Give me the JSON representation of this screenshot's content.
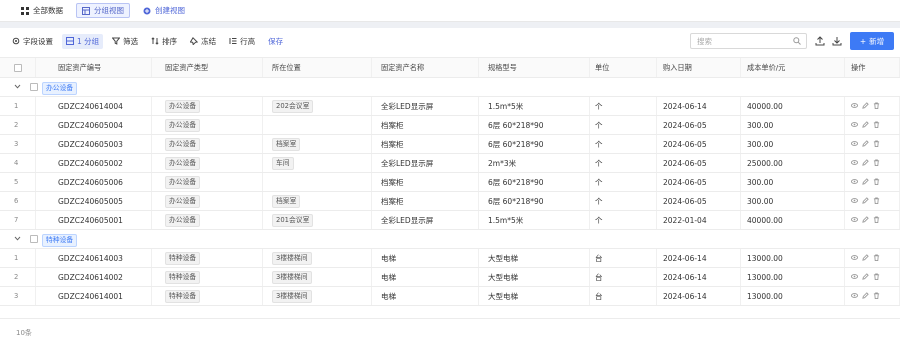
{
  "view_tabs": [
    {
      "label": "全部数据",
      "icon": "grid-icon",
      "active": false
    },
    {
      "label": "分组视图",
      "icon": "table-icon",
      "active": true
    },
    {
      "label": "创建视图",
      "icon": "plus-circle-icon",
      "active": false
    }
  ],
  "toolbar": {
    "field_settings": "字段设置",
    "group": "1 分组",
    "filter": "筛选",
    "sort": "排序",
    "freeze": "冻结",
    "row_height": "行高",
    "save": "保存",
    "search_placeholder": "搜索",
    "new_button": "新增"
  },
  "columns": [
    "固定资产编号",
    "固定资产类型",
    "所在位置",
    "固定资产名称",
    "规格型号",
    "单位",
    "购入日期",
    "成本单价/元",
    "操作"
  ],
  "groups": [
    {
      "name": "办公设备",
      "rows": [
        {
          "index": "1",
          "code": "GDZC240614004",
          "type": "办公设备",
          "location": "202会议室",
          "name": "全彩LED显示屏",
          "spec": "1.5m*5米",
          "unit": "个",
          "date": "2024-06-14",
          "price": "40000.00"
        },
        {
          "index": "2",
          "code": "GDZC240605004",
          "type": "办公设备",
          "location": "",
          "name": "档案柜",
          "spec": "6层 60*218*90",
          "unit": "个",
          "date": "2024-06-05",
          "price": "300.00"
        },
        {
          "index": "3",
          "code": "GDZC240605003",
          "type": "办公设备",
          "location": "档案室",
          "name": "档案柜",
          "spec": "6层 60*218*90",
          "unit": "个",
          "date": "2024-06-05",
          "price": "300.00"
        },
        {
          "index": "4",
          "code": "GDZC240605002",
          "type": "办公设备",
          "location": "车间",
          "name": "全彩LED显示屏",
          "spec": "2m*3米",
          "unit": "个",
          "date": "2024-06-05",
          "price": "25000.00"
        },
        {
          "index": "5",
          "code": "GDZC240605006",
          "type": "办公设备",
          "location": "",
          "name": "档案柜",
          "spec": "6层 60*218*90",
          "unit": "个",
          "date": "2024-06-05",
          "price": "300.00"
        },
        {
          "index": "6",
          "code": "GDZC240605005",
          "type": "办公设备",
          "location": "档案室",
          "name": "档案柜",
          "spec": "6层 60*218*90",
          "unit": "个",
          "date": "2024-06-05",
          "price": "300.00"
        },
        {
          "index": "7",
          "code": "GDZC240605001",
          "type": "办公设备",
          "location": "201会议室",
          "name": "全彩LED显示屏",
          "spec": "1.5m*5米",
          "unit": "个",
          "date": "2022-01-04",
          "price": "40000.00"
        }
      ]
    },
    {
      "name": "特种设备",
      "rows": [
        {
          "index": "1",
          "code": "GDZC240614003",
          "type": "特种设备",
          "location": "3楼楼梯间",
          "name": "电梯",
          "spec": "大型电梯",
          "unit": "台",
          "date": "2024-06-14",
          "price": "13000.00"
        },
        {
          "index": "2",
          "code": "GDZC240614002",
          "type": "特种设备",
          "location": "3楼楼梯间",
          "name": "电梯",
          "spec": "大型电梯",
          "unit": "台",
          "date": "2024-06-14",
          "price": "13000.00"
        },
        {
          "index": "3",
          "code": "GDZC240614001",
          "type": "特种设备",
          "location": "3楼楼梯间",
          "name": "电梯",
          "spec": "大型电梯",
          "unit": "台",
          "date": "2024-06-14",
          "price": "13000.00"
        }
      ]
    }
  ],
  "footer": {
    "count_label": "10条"
  },
  "colors": {
    "accent": "#3d7af5",
    "tag_bg": "#e8f1ff"
  }
}
